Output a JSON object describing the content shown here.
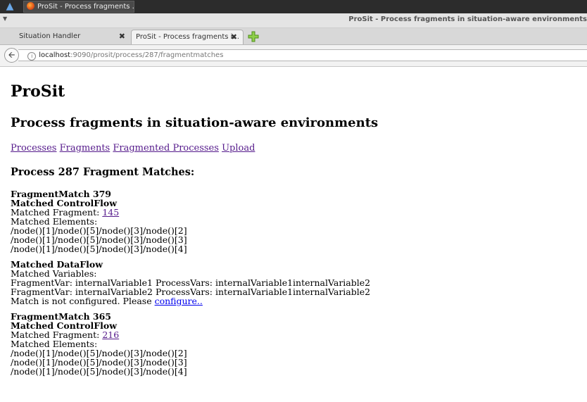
{
  "taskbar": {
    "task_label": "ProSit - Process fragments ..."
  },
  "window": {
    "title": "ProSit - Process fragments in situation-aware environments"
  },
  "tabs": [
    {
      "label": "Situation Handler"
    },
    {
      "label": "ProSit - Process fragments i..."
    }
  ],
  "address_bar": {
    "host": "localhost",
    "path": ":9090/prosit/process/287/fragmentmatches"
  },
  "page": {
    "heading": "ProSit",
    "subheading": "Process fragments in situation-aware environments",
    "nav_links": [
      "Processes",
      "Fragments",
      "Fragmented Processes",
      "Upload"
    ],
    "section_title": "Process 287 Fragment Matches:",
    "matches": [
      {
        "title": "FragmentMatch 379",
        "control_flow_title": "Matched ControlFlow",
        "matched_fragment_label": "Matched Fragment: ",
        "matched_fragment_id": "145",
        "matched_elements_label": "Matched Elements:",
        "elements": [
          "/node()[1]/node()[5]/node()[3]/node()[2]",
          "/node()[1]/node()[5]/node()[3]/node()[3]",
          "/node()[1]/node()[5]/node()[3]/node()[4]"
        ],
        "data_flow_title": "Matched DataFlow",
        "matched_variables_label": "Matched Variables:",
        "variables": [
          "FragmentVar: internalVariable1 ProcessVars: internalVariable1internalVariable2",
          "FragmentVar: internalVariable2 ProcessVars: internalVariable1internalVariable2"
        ],
        "config_text": "Match is not configured. Please ",
        "config_link": "configure.."
      },
      {
        "title": "FragmentMatch 365",
        "control_flow_title": "Matched ControlFlow",
        "matched_fragment_label": "Matched Fragment: ",
        "matched_fragment_id": "216",
        "matched_elements_label": "Matched Elements:",
        "elements": [
          "/node()[1]/node()[5]/node()[3]/node()[2]",
          "/node()[1]/node()[5]/node()[3]/node()[3]",
          "/node()[1]/node()[5]/node()[3]/node()[4]"
        ]
      }
    ]
  }
}
